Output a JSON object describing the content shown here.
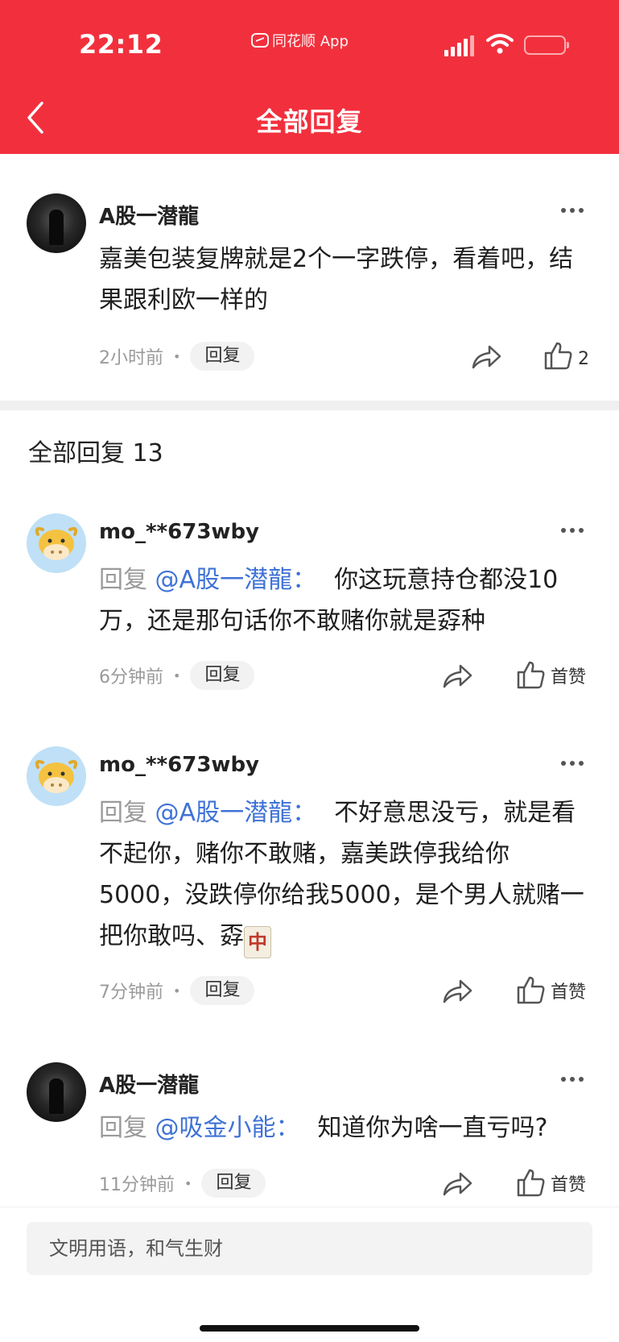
{
  "status_bar": {
    "time": "22:12",
    "app_label": "同花顺 App"
  },
  "header": {
    "title": "全部回复"
  },
  "main_comment": {
    "username": "A股一潜龍",
    "text": "嘉美包装复牌就是2个一字跌停，看着吧，结果跟利欧一样的",
    "time": "2小时前",
    "reply_label": "回复",
    "like_count": "2"
  },
  "section": {
    "title": "全部回复 13"
  },
  "replies": [
    {
      "username": "mo_**673wby",
      "reply_prefix": "回复",
      "mention": "@A股一潜龍：",
      "text": "你这玩意持仓都没10万，还是那句话你不敢赌你就是孬种",
      "time": "6分钟前",
      "reply_label": "回复",
      "like_label": "首赞"
    },
    {
      "username": "mo_**673wby",
      "reply_prefix": "回复",
      "mention": "@A股一潜龍：",
      "text": "不好意思没亏，就是看不起你，赌你不敢赌，嘉美跌停我给你5000，没跌停你给我5000，是个男人就赌一把你敢吗、孬",
      "emoji": "中",
      "time": "7分钟前",
      "reply_label": "回复",
      "like_label": "首赞"
    },
    {
      "username": "A股一潜龍",
      "reply_prefix": "回复",
      "mention": "@吸金小能：",
      "text": "知道你为啥一直亏吗?",
      "time": "11分钟前",
      "reply_label": "回复",
      "like_label": "首赞"
    }
  ],
  "input": {
    "placeholder": "文明用语，和气生财"
  },
  "colors": {
    "brand_red": "#f2303d",
    "mention_blue": "#3f72d6"
  }
}
